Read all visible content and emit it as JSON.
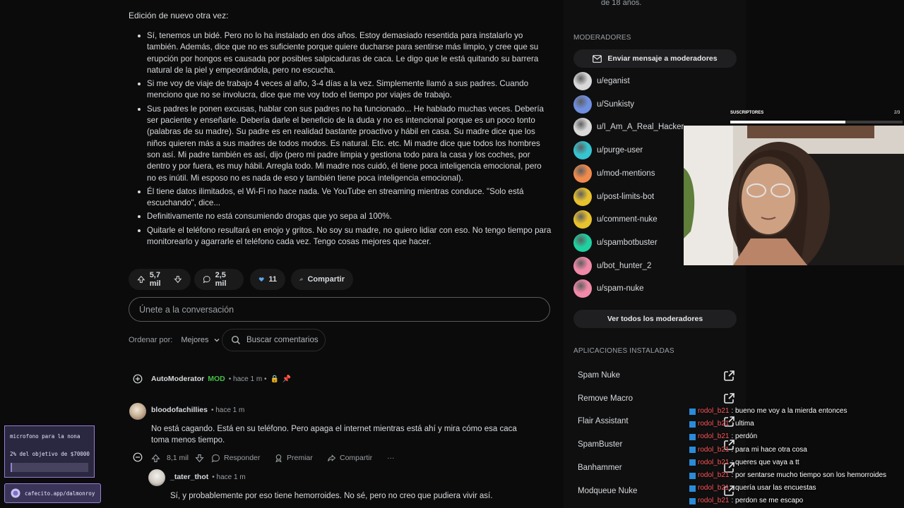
{
  "post": {
    "intro": "Edición de nuevo otra vez:",
    "bullets": [
      "Sí, tenemos un bidé. Pero no lo ha instalado en dos años. Estoy demasiado resentida para instalarlo yo también. Además, dice que no es suficiente porque quiere ducharse para sentirse más limpio, y cree que su erupción por hongos es causada por posibles salpicaduras de caca. Le digo que le está quitando su barrera natural de la piel y empeorándola, pero no escucha.",
      "Si me voy de viaje de trabajo 4 veces al año, 3-4 días a la vez. Simplemente llamó a sus padres. Cuando menciono que no se involucra, dice que me voy todo el tiempo por viajes de trabajo.",
      "Sus padres le ponen excusas, hablar con sus padres no ha funcionado... He hablado muchas veces. Debería ser paciente y enseñarle. Debería darle el beneficio de la duda y no es intencional porque es un poco tonto (palabras de su madre). Su padre es en realidad bastante proactivo y hábil en casa. Su madre dice que los niños quieren más a sus madres de todos modos. Es natural. Etc. etc. Mi madre dice que todos los hombres son así. Mi padre también es así, dijo (pero mi padre limpia y gestiona todo para la casa y los coches, por dentro y por fuera, es muy hábil. Arregla todo. Mi madre nos cuidó, él tiene poca inteligencia emocional, pero no es inútil. Mi esposo no es nada de eso y también tiene poca inteligencia emocional).",
      "Él tiene datos ilimitados, el Wi-Fi no hace nada. Ve YouTube en streaming mientras conduce. \"Solo está escuchando\", dice...",
      "Definitivamente no está consumiendo drogas que yo sepa al 100%.",
      "Quitarle el teléfono resultará en enojo y gritos. No soy su madre, no quiero lidiar con eso. No tengo tiempo para monitorearlo y agarrarle el teléfono cada vez. Tengo cosas mejores que hacer."
    ],
    "votes": "5,7 mil",
    "comments": "2,5 mil",
    "awards": "11",
    "share": "Compartir",
    "join_placeholder": "Únete a la conversación",
    "sort_label": "Ordenar por:",
    "sort_value": "Mejores",
    "search_comments": "Buscar comentarios"
  },
  "comments": [
    {
      "author": "AutoModerator",
      "mod": "MOD",
      "time": "• hace 1 m •",
      "text": ""
    },
    {
      "author": "bloodofachillies",
      "time": "• hace 1 m",
      "text": "No está cagando. Está en su teléfono. Pero apaga el internet mientras está ahí y mira cómo esa caca toma menos tiempo.",
      "votes": "8,1 mil",
      "reply": "Responder",
      "award": "Premiar",
      "share": "Compartir",
      "more": "···"
    },
    {
      "author": "_tater_thot",
      "time": "• hace 1 m",
      "text": "Sí, y probablemente por eso tiene hemorroides. No sé, pero no creo que pudiera vivir así."
    }
  ],
  "sidebar": {
    "top_text": "de 18 años.",
    "mods_title": "MODERADORES",
    "message_mods": "Enviar mensaje a moderadores",
    "moderators": [
      {
        "name": "u/eganist",
        "color": "#d9d9d9"
      },
      {
        "name": "u/Sunkisty",
        "color": "#6f8fe0"
      },
      {
        "name": "u/I_Am_A_Real_Hacker",
        "color": "#d9d9d9"
      },
      {
        "name": "u/purge-user",
        "color": "#36c5d0"
      },
      {
        "name": "u/mod-mentions",
        "color": "#ef8a4d"
      },
      {
        "name": "u/post-limits-bot",
        "color": "#e7c12e"
      },
      {
        "name": "u/comment-nuke",
        "color": "#e7c12e"
      },
      {
        "name": "u/spambotbuster",
        "color": "#1fd1a0"
      },
      {
        "name": "u/bot_hunter_2",
        "color": "#f08aa8"
      },
      {
        "name": "u/spam-nuke",
        "color": "#f08aa8"
      }
    ],
    "see_all_mods": "Ver todos los moderadores",
    "apps_title": "APLICACIONES INSTALADAS",
    "apps": [
      "Spam Nuke",
      "Remove Macro",
      "Flair Assistant",
      "SpamBuster",
      "Banhammer",
      "Modqueue Nuke"
    ]
  },
  "stream": {
    "subs_label": "SUSCRIPTORES",
    "subs_count": "2/3",
    "subs_progress": 0.67,
    "chat": [
      {
        "user": "rodol_b21",
        "msg": ": bueno me voy a la mierda entonces"
      },
      {
        "user": "rodol_b21",
        "msg": ": ultima"
      },
      {
        "user": "rodol_b21",
        "msg": ": perdón"
      },
      {
        "user": "rodol_b21",
        "msg": ": para mi hace otra cosa"
      },
      {
        "user": "rodol_b21",
        "msg": ": queres que vaya a tt"
      },
      {
        "user": "rodol_b21",
        "msg": ": por sentarse mucho tiempo son los hemorroides"
      },
      {
        "user": "rodol_b21",
        "msg": ": quería usar las encuestas"
      },
      {
        "user": "rodol_b21",
        "msg": ": perdon se me escapo"
      }
    ],
    "goal_title": "microfono para la nona",
    "goal_text": "2% del objetivo de $70000",
    "goal_progress": 0.02,
    "cafecito": "cafecito.app/dalmonroy"
  }
}
